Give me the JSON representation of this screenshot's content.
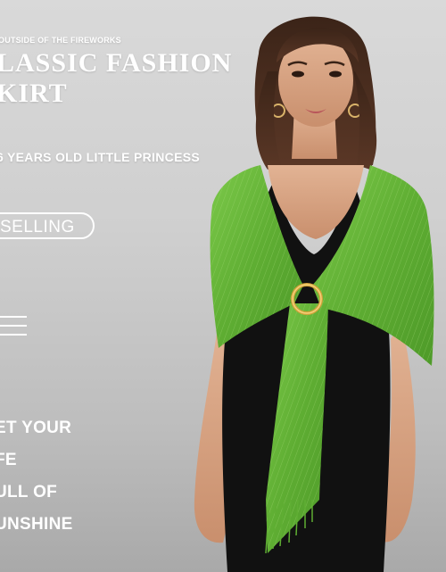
{
  "banner": {
    "kicker": "OUTSIDE OF THE FIREWORKS",
    "title_line1": "LASSIC FASHION",
    "title_line2": "KIRT",
    "subtitle": "6 YEARS OLD LITTLE PRINCESS",
    "button_label": "SELLING",
    "slogan": [
      "ET YOUR",
      "FE",
      "ULL OF",
      "UNSHINE"
    ]
  },
  "colors": {
    "background": "#c8c8c8",
    "shawl_green": "#69b83a",
    "dress": "#111111",
    "text": "#ffffff"
  },
  "icons": [
    "menu-icon"
  ]
}
